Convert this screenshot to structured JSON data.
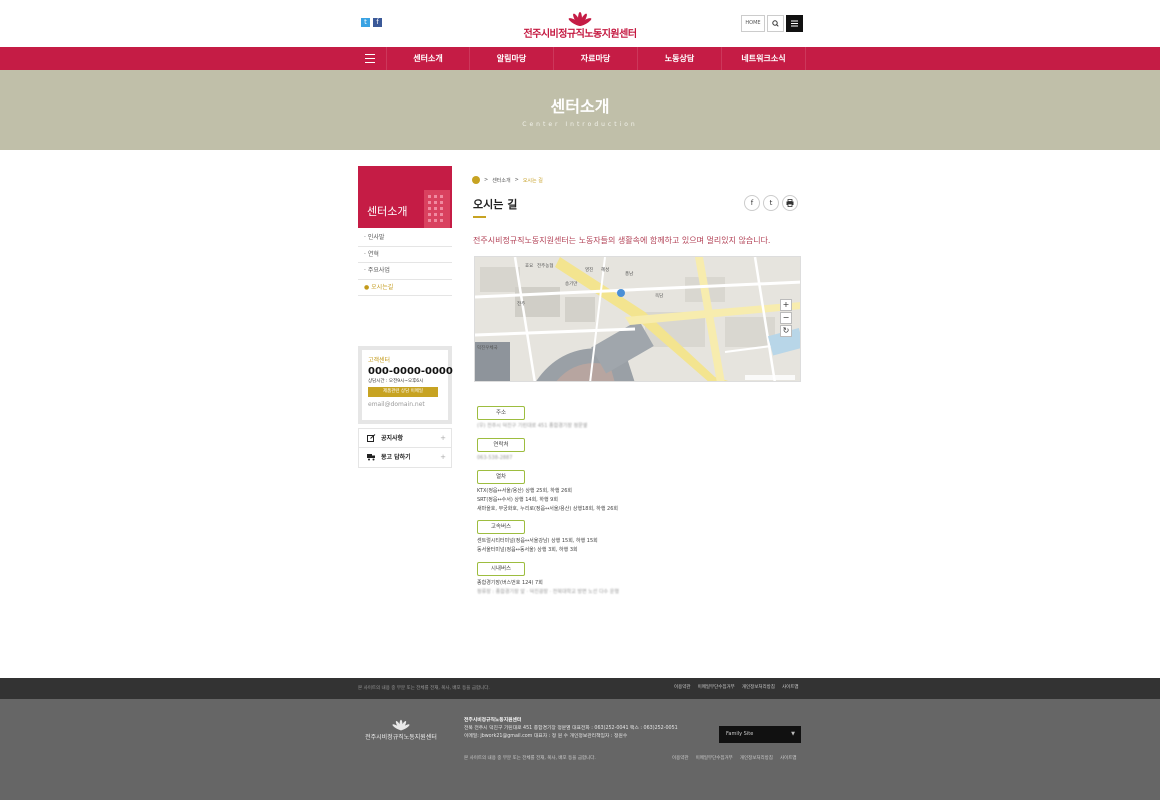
{
  "header": {
    "site_name": "전주시비정규직노동지원센터",
    "home_label": "HOME",
    "sns": {
      "twitter_glyph": "t",
      "facebook_glyph": "f"
    }
  },
  "nav": {
    "items": [
      "센터소개",
      "알림마당",
      "자료마당",
      "노동상담",
      "네트워크소식"
    ]
  },
  "banner": {
    "title": "센터소개",
    "subtitle": "Center Introduction"
  },
  "sidebar": {
    "title": "센터소개",
    "items": [
      {
        "label": "인사말",
        "active": false
      },
      {
        "label": "연혁",
        "active": false
      },
      {
        "label": "주요사업",
        "active": false
      },
      {
        "label": "오시는길",
        "active": true
      }
    ],
    "customer": {
      "label": "고객센터",
      "phone": "000-0000-0000",
      "hours": "상담시간 : 오전9시~오후6시",
      "badge": "제품관련 상담 이메일",
      "email": "email@domain.net"
    },
    "quick": [
      {
        "label": "공지사항"
      },
      {
        "label": "몽고 답하기"
      }
    ]
  },
  "content": {
    "breadcrumb": [
      "센터소개",
      "오시는 길"
    ],
    "page_title": "오시는 길",
    "intro": "전주시비정규직노동지원센터는 노동자들의 생활속에 함께하고 있으며 멀리있지 않습니다.",
    "share": [
      "f",
      "t",
      "p"
    ],
    "map": {
      "zoom_in": "+",
      "zoom_out": "−",
      "reset": "↻",
      "places": [
        "효요",
        "전주농협",
        "영진",
        "혜성",
        "풍남",
        "송기만",
        "옥담",
        "전주",
        "덕진우체국"
      ]
    },
    "info": [
      {
        "label": "주소",
        "lines": [
          "(우) 전주시 덕진구 기린대로 451 종합경기장 정문옆"
        ]
      },
      {
        "label": "연락처",
        "lines": [
          "063-538-2887"
        ]
      },
      {
        "label": "열차",
        "lines": [
          "KTX(정읍↔서울/용산) 상행 25회, 하행 26회",
          "SRT(정읍↔수서) 상행 14회, 하행 9회",
          "새마을호, 무궁화호, 누리로(정읍↔서울/용산) 상행18회, 하행 26회"
        ]
      },
      {
        "label": "고속버스",
        "lines": [
          "센트럴시티터미널(정읍↔서울강남) 상행 15회, 하행 15회",
          "동서울터미널(정읍↔동서울) 상행 3회, 하행 3회"
        ]
      },
      {
        "label": "시내버스",
        "lines": [
          "종합경기장(버스번호 124) 7회",
          "정류장 : 종합경기장 앞 · 덕진광장 · 전북대학교 방면 노선 다수 운행"
        ]
      }
    ]
  },
  "footer": {
    "top_left": "본 사이트의 내용 중 무분 또는 전체를 전재, 복사, 배포 등을 금합니다.",
    "top_links": [
      "이용약관",
      "이메일무단수집거부",
      "개인정보처리방침",
      "사이트맵"
    ],
    "org_name": "전주시비정규직노동지원센터",
    "address_line": "전북 전주시 덕진구 기린대로 451 종합경기장 정문옆   대표전화 : 063)252-0041   팩스 : 063)252-0051",
    "contact_line": "이메일: jbwork21@gmail.com  대표자 : 정 원 수    개인정보관리책임자 : 정원수",
    "family_site": "Family Site",
    "copyright": "본 사이트의 내용 중 무분 또는 전체를 전재, 복사, 배포 등을 금합니다.",
    "bottom_links": [
      "이용약관",
      "이메일무단수집거부",
      "개인정보처리방침",
      "사이트맵"
    ]
  },
  "colors": {
    "brand": "#c51c45",
    "banner": "#c0bfa9",
    "accent_gold": "#c7a322",
    "label_border": "#9dbd3f"
  }
}
